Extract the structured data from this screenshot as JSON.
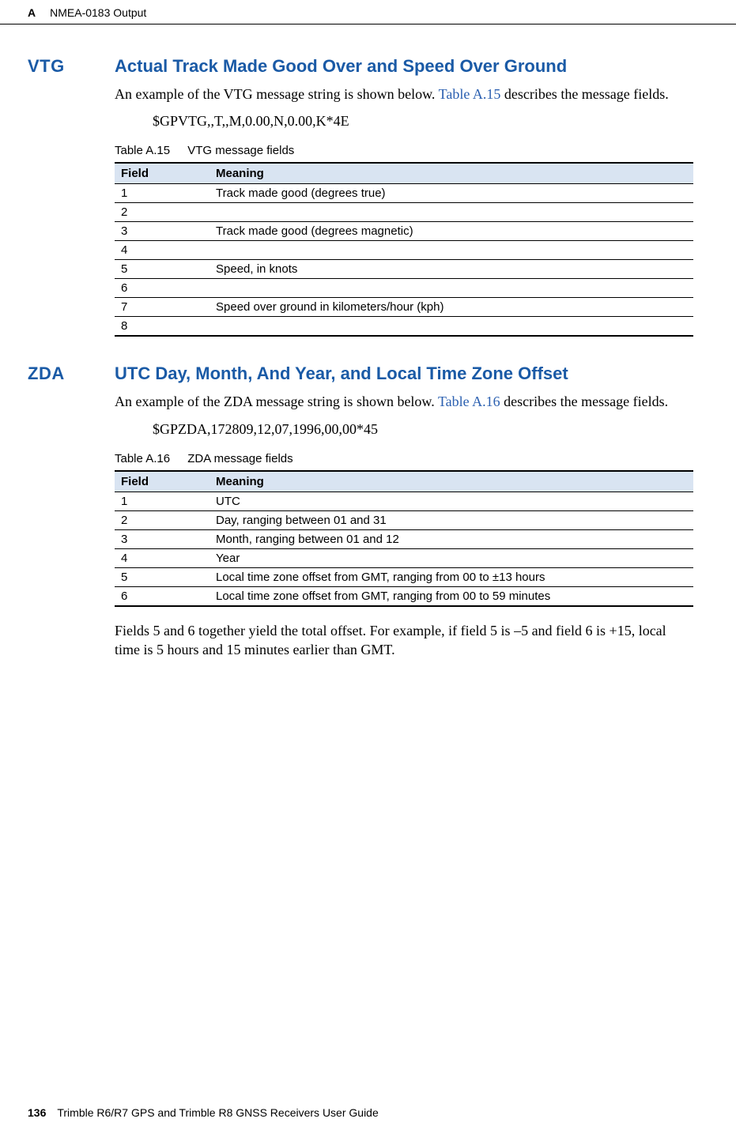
{
  "header": {
    "appendix_letter": "A",
    "appendix_title": "NMEA-0183 Output"
  },
  "section_vtg": {
    "tag": "VTG",
    "title": "Actual Track Made Good Over and Speed Over Ground",
    "intro_before_link": "An example of the VTG message string is shown below. ",
    "intro_link": "Table A.15",
    "intro_after_link": " describes the message fields.",
    "example": "$GPVTG,,T,,M,0.00,N,0.00,K*4E",
    "table_label": "Table A.15",
    "table_title": "VTG message fields",
    "col_field": "Field",
    "col_meaning": "Meaning",
    "rows": [
      {
        "field": "1",
        "meaning": "Track made good (degrees true)"
      },
      {
        "field": "2",
        "meaning": ""
      },
      {
        "field": "3",
        "meaning": "Track made good (degrees magnetic)"
      },
      {
        "field": "4",
        "meaning": ""
      },
      {
        "field": "5",
        "meaning": "Speed, in knots"
      },
      {
        "field": "6",
        "meaning": ""
      },
      {
        "field": "7",
        "meaning": "Speed over ground in kilometers/hour (kph)"
      },
      {
        "field": "8",
        "meaning": ""
      }
    ]
  },
  "section_zda": {
    "tag": "ZDA",
    "title": "UTC Day, Month, And Year, and Local Time Zone Offset",
    "intro_before_link": "An example of the ZDA message string is shown below. ",
    "intro_link": "Table A.16",
    "intro_after_link": " describes the message fields.",
    "example": "$GPZDA,172809,12,07,1996,00,00*45",
    "table_label": "Table A.16",
    "table_title": "ZDA message fields",
    "col_field": "Field",
    "col_meaning": "Meaning",
    "rows": [
      {
        "field": "1",
        "meaning": "UTC"
      },
      {
        "field": "2",
        "meaning": "Day, ranging between 01 and 31"
      },
      {
        "field": "3",
        "meaning": "Month, ranging between 01 and 12"
      },
      {
        "field": "4",
        "meaning": "Year"
      },
      {
        "field": "5",
        "meaning": "Local time zone offset from GMT, ranging from 00 to ±13 hours"
      },
      {
        "field": "6",
        "meaning": "Local time zone offset from GMT, ranging from 00 to 59 minutes"
      }
    ],
    "postscript": "Fields 5 and 6 together yield the total offset. For example, if field 5 is –5 and field 6 is +15, local time is 5 hours and 15 minutes earlier than GMT."
  },
  "footer": {
    "page_number": "136",
    "book_title": "Trimble R6/R7 GPS and Trimble R8 GNSS Receivers User Guide"
  }
}
